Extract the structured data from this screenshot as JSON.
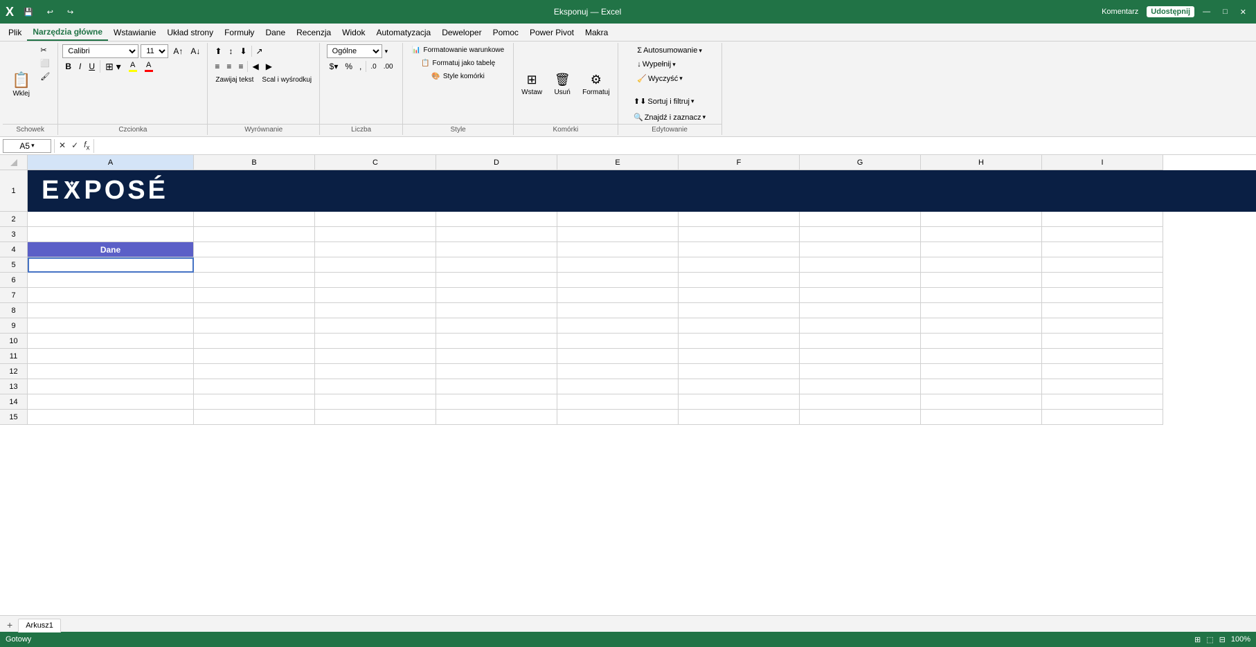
{
  "app": {
    "title": "Eksponuj — Excel",
    "file_name": "Eksponuj",
    "app_name": "Excel"
  },
  "title_bar": {
    "quick_access": [
      "save",
      "undo",
      "redo"
    ],
    "title": "Eksponuj — Excel",
    "btn_komentarz": "Komentarz",
    "btn_udostep": "Udostępnij"
  },
  "menu": {
    "items": [
      "Plik",
      "Narzędzia główne",
      "Wstawianie",
      "Układ strony",
      "Formuły",
      "Dane",
      "Recenzja",
      "Widok",
      "Automatyzacja",
      "Deweloper",
      "Pomoc",
      "Power Pivot",
      "Makra"
    ],
    "active": "Narzędzia główne"
  },
  "ribbon": {
    "groups": {
      "schowek": {
        "label": "Schowek",
        "wklej": "Wklej",
        "wytnij": "✂",
        "kopiuj": "⬜",
        "malarz": "🖌"
      },
      "czcionka": {
        "label": "Czcionka",
        "font_name": "Calibri",
        "font_size": "11",
        "bold": "B",
        "italic": "I",
        "underline": "U",
        "border": "⊞",
        "fill": "A",
        "color": "A",
        "increase_size": "A↑",
        "decrease_size": "A↓"
      },
      "wyrownanie": {
        "label": "Wyrównanie",
        "align_left": "≡",
        "align_center": "≡",
        "align_right": "≡",
        "align_top": "⊤",
        "align_middle": "⊤",
        "align_bottom": "⊥",
        "wrap_text": "Zawijaj tekst",
        "merge": "Scal i wyśrodkuj",
        "indent_dec": "◀",
        "indent_inc": "▶",
        "orient": "↗"
      },
      "liczba": {
        "label": "Liczba",
        "format": "Ogólne",
        "percent": "%",
        "thousands": "000",
        "increase_dec": ".0→.00",
        "decrease_dec": ".00→.0",
        "currency": "zł"
      },
      "style": {
        "label": "Style",
        "formatowanie_war": "Formatowanie warunkowe",
        "formatuj_tabele": "Formatuj jako tabelę",
        "style_komorki": "Style komórki"
      },
      "komorki": {
        "label": "Komórki",
        "wstaw": "Wstaw",
        "usun": "Usuń",
        "formatuj": "Formatuj"
      },
      "edytowanie": {
        "label": "Edytowanie",
        "autosumowanie": "Autosumowanie",
        "wypelnij": "Wypełnij",
        "wyczysc": "Wyczyść",
        "sortuj": "Sortuj i filtruj",
        "znajdz": "Znajdź i zaznacz"
      }
    }
  },
  "formula_bar": {
    "cell_ref": "A5",
    "formula": ""
  },
  "columns": {
    "headers": [
      "A",
      "B",
      "C",
      "D",
      "E",
      "F",
      "G",
      "H",
      "I"
    ],
    "widths": [
      240,
      175,
      175,
      175,
      175,
      175,
      175,
      175,
      175
    ]
  },
  "rows": {
    "count": 15,
    "banner_row": 1,
    "banner_text": "EXPOSÉ",
    "header_row": 4,
    "header_cell_a": "Dane",
    "data_rows": [
      5,
      6,
      7,
      8,
      9,
      10
    ],
    "empty_rows": [
      2,
      3,
      11,
      12,
      13,
      14,
      15
    ]
  },
  "cells": {
    "A4": {
      "value": "Dane",
      "type": "header",
      "bg": "#5b5fc7",
      "color": "white",
      "bold": true,
      "align": "center"
    },
    "A5": {
      "value": "",
      "selected": true
    },
    "A6": {
      "value": ""
    },
    "A7": {
      "value": ""
    },
    "A8": {
      "value": ""
    },
    "A9": {
      "value": ""
    },
    "A10": {
      "value": ""
    }
  },
  "sheet_tabs": {
    "sheets": [
      "Arkusz1"
    ],
    "active": "Arkusz1"
  },
  "status_bar": {
    "mode": "Gotowy",
    "zoom": "100%",
    "view_normal": "⊞",
    "view_page": "⬚",
    "view_preview": "⊟"
  }
}
